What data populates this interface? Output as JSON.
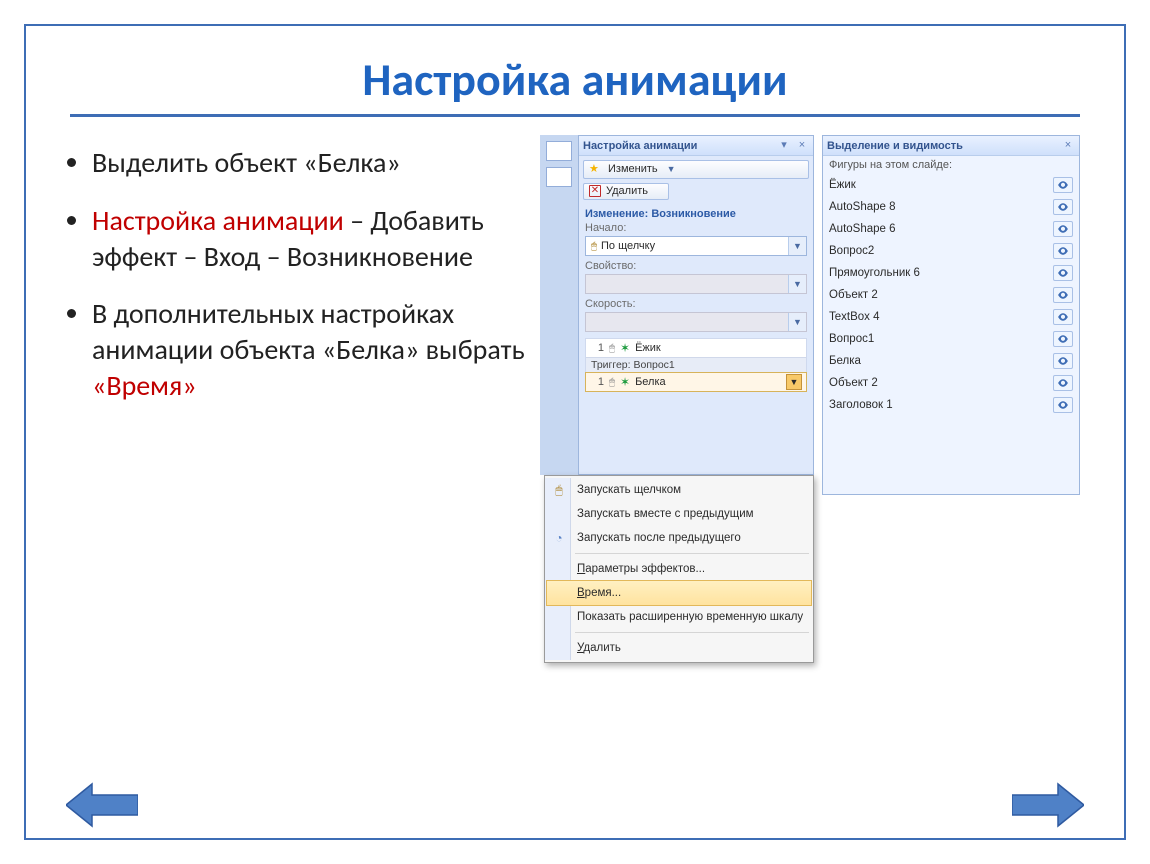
{
  "title": "Настройка анимации",
  "bullets": {
    "b1": "Выделить объект «Белка»",
    "b2_part1": "Настройка анимации",
    "b2_part2": " – Добавить эффект – Вход – Возникновение",
    "b3_part1": "В дополнительных настройках анимации объекта «Белка» выбрать ",
    "b3_red": "«Время»"
  },
  "anim_pane": {
    "title": "Настройка анимации",
    "btn_change": "Изменить",
    "btn_delete": "Удалить",
    "section": "Изменение: Возникновение",
    "start_label": "Начало:",
    "start_value": "По щелчку",
    "prop_label": "Свойство:",
    "speed_label": "Скорость:",
    "item1_num": "1",
    "item1_name": "Ёжик",
    "trigger": "Триггер: Вопрос1",
    "item2_num": "1",
    "item2_name": "Белка"
  },
  "menu": {
    "m1": "Запускать щелчком",
    "m2": "Запускать вместе с предыдущим",
    "m3": "Запускать после предыдущего",
    "m4_u": "П",
    "m4_rest": "араметры эффектов...",
    "m5_u": "В",
    "m5_rest": "ремя...",
    "m6": "Показать расширенную временную шкалу",
    "m7_u": "У",
    "m7_rest": "далить"
  },
  "vis_pane": {
    "title": "Выделение и видимость",
    "sub": "Фигуры на этом слайде:",
    "items": [
      "Ёжик",
      "AutoShape 8",
      "AutoShape 6",
      "Вопрос2",
      "Прямоугольник 6",
      "Объект 2",
      "TextBox 4",
      "Вопрос1",
      "Белка",
      "Объект 2",
      "Заголовок 1"
    ]
  }
}
